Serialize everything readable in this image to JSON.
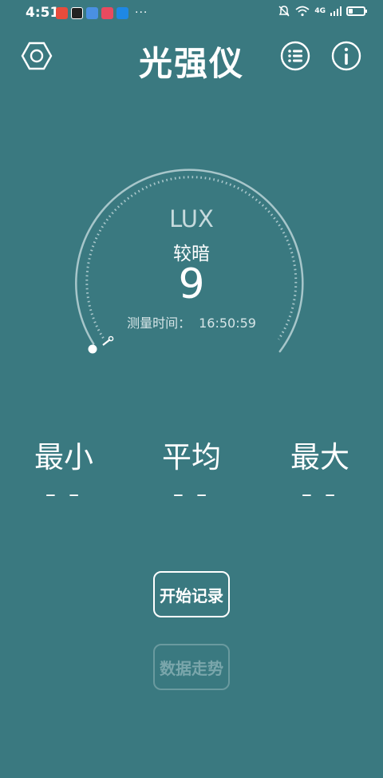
{
  "status_bar": {
    "time": "4:51",
    "more": "···",
    "network": "4G"
  },
  "header": {
    "title": "光强仪",
    "settings_icon": "hex-nut-icon",
    "list_icon": "list-icon",
    "info_icon": "info-icon"
  },
  "gauge": {
    "unit": "LUX",
    "level": "较暗",
    "value": "9",
    "measure_label": "测量时间：",
    "measure_time": "16:50:59",
    "fill_fraction": 0.0
  },
  "stats": {
    "min_label": "最小",
    "min_value": "– –",
    "avg_label": "平均",
    "avg_value": "– –",
    "max_label": "最大",
    "max_value": "– –"
  },
  "buttons": {
    "start_record": "开始记录",
    "data_trend": "数据走势"
  },
  "colors": {
    "background": "#3A7980",
    "foreground": "#FFFFFF",
    "disabled": "#7AA6AB"
  }
}
